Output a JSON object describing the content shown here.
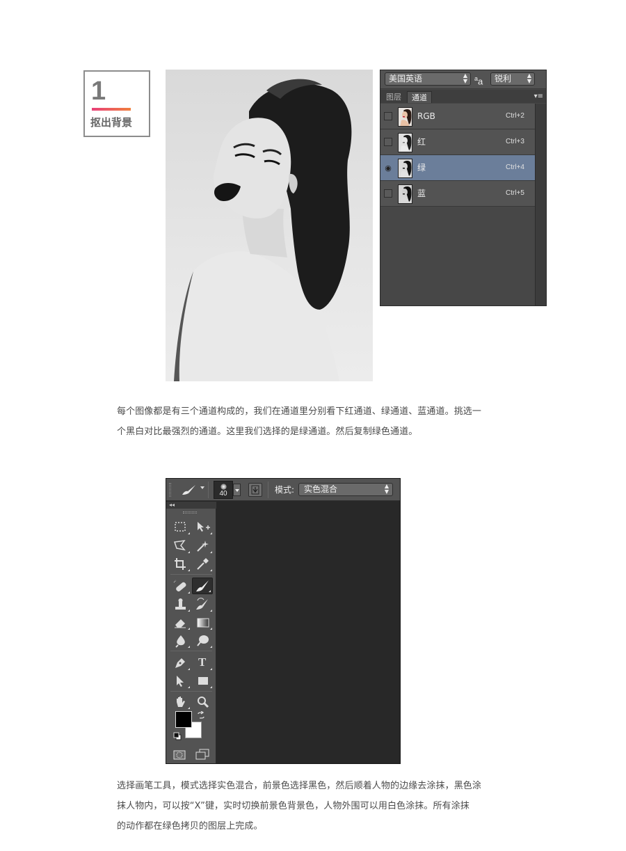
{
  "step": {
    "number": "1",
    "title": "抠出背景"
  },
  "photo": {
    "alt": "black-and-white portrait"
  },
  "channels_panel": {
    "language_select": "美国英语",
    "aa_glyph": "a",
    "aa_glyph_small": "a",
    "antialias_select": "锐利",
    "tabs": [
      {
        "label": "图层",
        "active": false
      },
      {
        "label": "通道",
        "active": true
      }
    ],
    "menu_glyph": "▾≡",
    "channels": [
      {
        "name": "RGB",
        "shortcut": "Ctrl+2",
        "visible": false,
        "active": false
      },
      {
        "name": "红",
        "shortcut": "Ctrl+3",
        "visible": false,
        "active": false
      },
      {
        "name": "绿",
        "shortcut": "Ctrl+4",
        "visible": true,
        "active": true
      },
      {
        "name": "蓝",
        "shortcut": "Ctrl+5",
        "visible": false,
        "active": false
      }
    ]
  },
  "paragraph_1": {
    "line_1": "每个图像都是有三个通道构成的，我们在通道里分别看下红通道、绿通道、蓝通道。挑选一",
    "line_2": "个黑白对比最强烈的通道。这里我们选择的是绿通道。然后复制绿色通道。"
  },
  "tools_window": {
    "brush_size": "40",
    "mode_label": "模式:",
    "mode_value": "实色混合",
    "collapse_glyph": "◂◂",
    "foreground_color": "#000000",
    "background_color": "#ffffff",
    "selected_tool": "brush-tool",
    "tools": [
      "rectangular-marquee-tool",
      "move-tool",
      "polygonal-lasso-tool",
      "magic-wand-tool",
      "crop-tool",
      "eyedropper-tool",
      "spot-healing-brush-tool",
      "brush-tool",
      "clone-stamp-tool",
      "history-brush-tool",
      "eraser-tool",
      "gradient-tool",
      "blur-tool",
      "dodge-tool",
      "pen-tool",
      "type-tool",
      "path-selection-tool",
      "rectangle-tool",
      "hand-tool",
      "zoom-tool"
    ],
    "type_tool_glyph": "T"
  },
  "paragraph_2": {
    "line_1": "选择画笔工具，模式选择实色混合，前景色选择黑色，然后顺着人物的边缘去涂抹，黑色涂",
    "line_2": "抹人物内，可以按“X”键，实时切换前景色背景色，人物外围可以用白色涂抹。所有涂抹",
    "line_3": "的动作都在绿色拷贝的图层上完成。"
  }
}
